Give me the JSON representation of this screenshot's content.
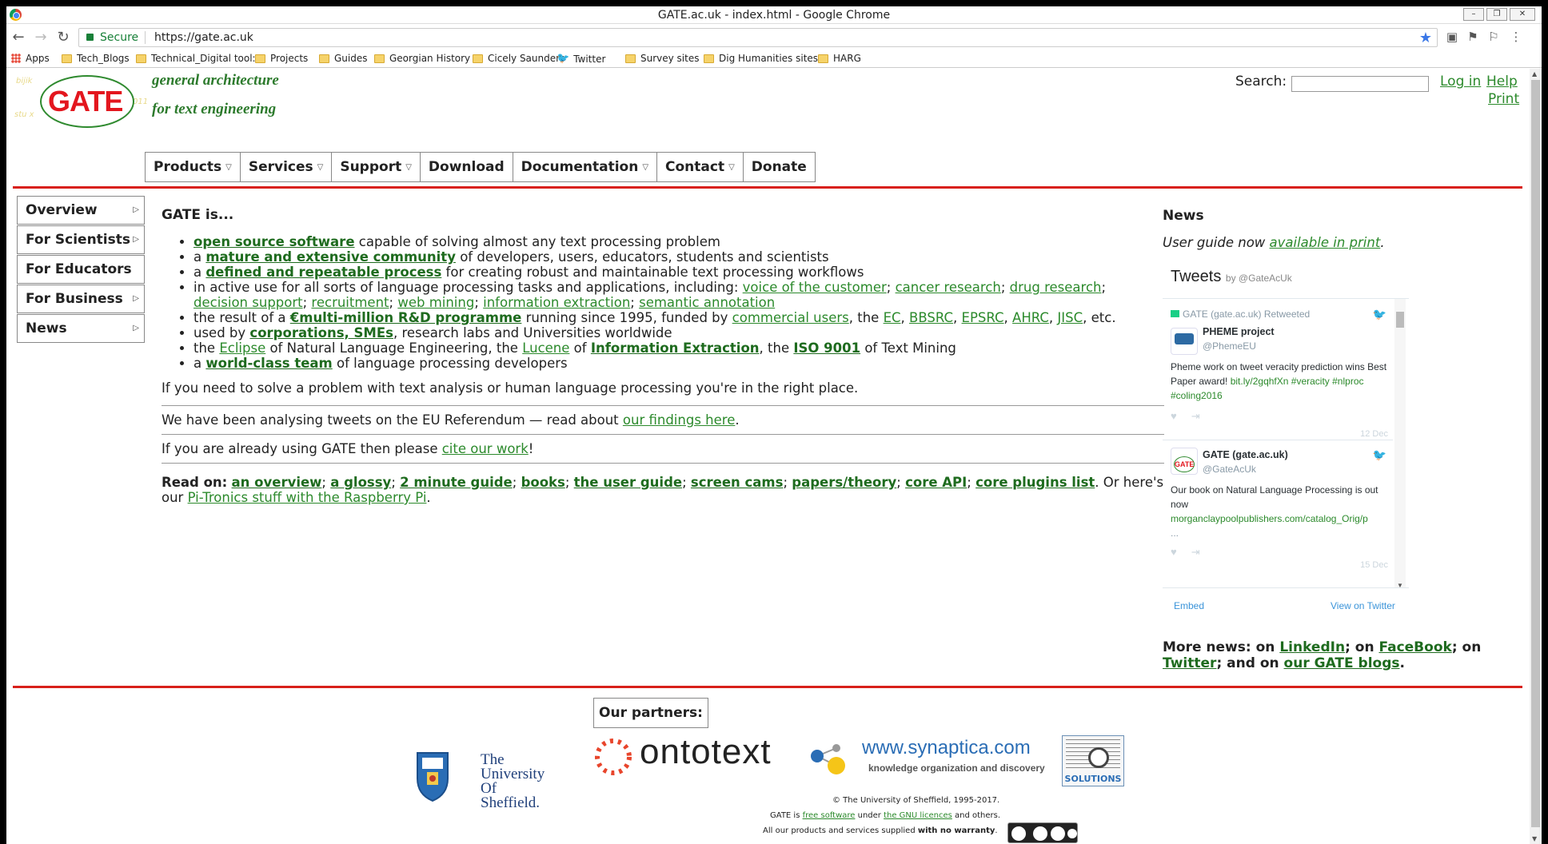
{
  "window": {
    "title": "GATE.ac.uk - index.html - Google Chrome"
  },
  "address_bar": {
    "secure_label": "Secure",
    "url": "https://gate.ac.uk"
  },
  "bookmarks": [
    {
      "label": "Apps",
      "icon": "apps-grid-icon"
    },
    {
      "label": "Tech_Blogs",
      "icon": "folder-icon"
    },
    {
      "label": "Technical_Digital tool:",
      "icon": "folder-icon"
    },
    {
      "label": "Projects",
      "icon": "folder-icon"
    },
    {
      "label": "Guides",
      "icon": "folder-icon"
    },
    {
      "label": "Georgian History",
      "icon": "folder-icon"
    },
    {
      "label": "Cicely Saunders",
      "icon": "folder-icon"
    },
    {
      "label": "Twitter",
      "icon": "twitter-bird-icon"
    },
    {
      "label": "Survey sites",
      "icon": "folder-icon"
    },
    {
      "label": "Dig Humanities sites a",
      "icon": "folder-icon"
    },
    {
      "label": "HARG",
      "icon": "folder-icon"
    }
  ],
  "header": {
    "logo_text": "GATE",
    "tagline1": "general architecture",
    "tagline2": "for text engineering",
    "search_label": "Search:",
    "login": "Log in",
    "help": "Help",
    "print": "Print"
  },
  "menu": [
    {
      "label": "Products",
      "dropdown": true
    },
    {
      "label": "Services",
      "dropdown": true
    },
    {
      "label": "Support",
      "dropdown": true
    },
    {
      "label": "Download",
      "dropdown": false
    },
    {
      "label": "Documentation",
      "dropdown": true
    },
    {
      "label": "Contact",
      "dropdown": true
    },
    {
      "label": "Donate",
      "dropdown": false
    }
  ],
  "sidebar": [
    {
      "label": "Overview",
      "arrow": true
    },
    {
      "label": "For Scientists",
      "arrow": true
    },
    {
      "label": "For Educators",
      "arrow": false
    },
    {
      "label": "For Business",
      "arrow": true
    },
    {
      "label": "News",
      "arrow": true
    }
  ],
  "main": {
    "heading": "GATE is...",
    "b1": {
      "link": "open source software",
      "rest": " capable of solving almost any text processing problem"
    },
    "b2": {
      "pre": "a ",
      "link": "mature and extensive community",
      "rest": " of developers, users, educators, students and scientists"
    },
    "b3": {
      "pre": "a ",
      "link": "defined and repeatable process",
      "rest": " for creating robust and maintainable text processing workflows"
    },
    "b4": {
      "pre": "in active use for all sorts of language processing tasks and applications, including: ",
      "l1": "voice of the customer",
      "l2": "cancer research",
      "l3": "drug research",
      "l4": "decision support",
      "l5": "recruitment",
      "l6": "web mining",
      "l7": "information extraction",
      "l8": "semantic annotation"
    },
    "b5": {
      "pre": "the result of a ",
      "link": "€multi-million R&D programme",
      "mid": " running since 1995, funded by ",
      "l1": "commercial users",
      "t1": ", the ",
      "l2": "EC",
      "l3": "BBSRC",
      "l4": "EPSRC",
      "l5": "AHRC",
      "l6": "JISC",
      "end": ", etc."
    },
    "b6": {
      "pre": "used by ",
      "link": "corporations, SMEs",
      "rest": ", research labs and Universities worldwide"
    },
    "b7": {
      "pre": "the ",
      "l1": "Eclipse",
      "t1": " of Natural Language Engineering, the ",
      "l2": "Lucene",
      "t2": " of ",
      "l3": "Information Extraction",
      "t3": ", the ",
      "l4": "ISO 9001",
      "t4": " of Text Mining"
    },
    "b8": {
      "pre": "a ",
      "link": "world-class team",
      "rest": " of language processing developers"
    },
    "p1": "If you need to solve a problem with text analysis or human language processing you're in the right place.",
    "p2": {
      "pre": "We have been analysing tweets on the EU Referendum — read about ",
      "link": "our findings here",
      "end": "."
    },
    "p3": {
      "pre": "If you are already using GATE then please ",
      "link": "cite our work",
      "end": "!"
    },
    "readon": {
      "label": "Read on:",
      "l1": "an overview",
      "l2": "a glossy",
      "l3": "2 minute guide",
      "l4": "books",
      "l5": "the user guide",
      "l6": "screen cams",
      "l7": "papers/theory",
      "l8": "core API",
      "l9": "core plugins list",
      "mid": ". Or here's our ",
      "l10": "Pi-Tronics stuff with the Raspberry Pi",
      "end": "."
    }
  },
  "news": {
    "heading": "News",
    "guide_pre": "User guide now ",
    "guide_link": "available in print",
    "guide_end": ".",
    "tweets": {
      "title": "Tweets",
      "by": "by @GateAcUk",
      "t1": {
        "retweet": "GATE (gate.ac.uk) Retweeted",
        "name": "PHEME project",
        "handle": "@PhemeEU",
        "text": "Pheme work on tweet veracity prediction wins Best Paper award!",
        "link": "bit.ly/2gqhfXn",
        "tags": "#veracity #nlproc #coling2016",
        "date": "12 Dec"
      },
      "t2": {
        "name": "GATE (gate.ac.uk)",
        "handle": "@GateAcUk",
        "text": "Our book on Natural Language Processing is out now",
        "link": "morganclaypoolpublishers.com/catalog_Orig/p",
        "ellipsis": "...",
        "date": "15 Dec"
      },
      "embed": "Embed",
      "view": "View on Twitter"
    },
    "more_pre": "More news: on ",
    "more_l1": "LinkedIn",
    "more_t1": "; on ",
    "more_l2": "FaceBook",
    "more_t2": "; on ",
    "more_l3": "Twitter",
    "more_t3": "; and on ",
    "more_l4": "our GATE blogs",
    "more_end": "."
  },
  "partners": {
    "label": "Our partners:",
    "sheffield": {
      "l1": "The",
      "l2": "University",
      "l3": "Of",
      "l4": "Sheffield."
    },
    "ontotext": "ontotext",
    "synaptica": {
      "name": "www.synaptica.com",
      "sub": "knowledge organization and discovery"
    },
    "solutions": "SOLUTIONS"
  },
  "footer": {
    "copyright": "© The University of Sheffield, 1995-2017.",
    "line2_pre": "GATE is ",
    "line2_l1": "free software",
    "line2_mid": " under ",
    "line2_l2": "the GNU licences",
    "line2_end": " and others.",
    "line3_pre": "All our products and services supplied ",
    "line3_bold": "with no warranty",
    "line3_end": "."
  },
  "colors": {
    "accent_green": "#2c8a2c",
    "rule_red": "#d8201a",
    "logo_red": "#e3161e"
  }
}
